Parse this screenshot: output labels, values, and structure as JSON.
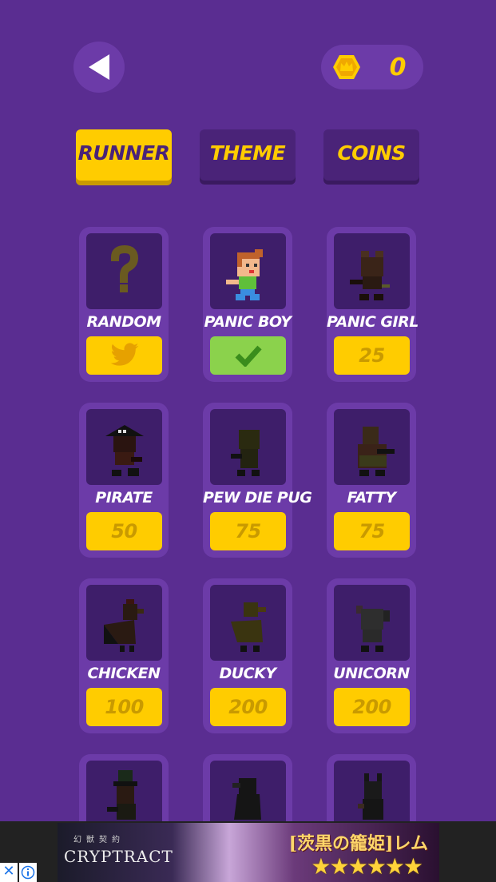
{
  "header": {
    "back_icon": "back-arrow-icon",
    "coin_icon": "crown-hexagon-coin-icon",
    "coin_count": "0"
  },
  "tabs": [
    {
      "label": "RUNNER",
      "active": true
    },
    {
      "label": "THEME",
      "active": false
    },
    {
      "label": "COINS",
      "active": false
    }
  ],
  "runners": [
    {
      "name": "RANDOM",
      "price": "",
      "button_icon": "twitter-icon",
      "owned": false
    },
    {
      "name": "PANIC BOY",
      "price": "",
      "button_icon": "checkmark-icon",
      "owned": true
    },
    {
      "name": "PANIC GIRL",
      "price": "25",
      "button_icon": "",
      "owned": false
    },
    {
      "name": "PIRATE",
      "price": "50",
      "button_icon": "",
      "owned": false
    },
    {
      "name": "PEW DIE PUG",
      "price": "75",
      "button_icon": "",
      "owned": false
    },
    {
      "name": "FATTY",
      "price": "75",
      "button_icon": "",
      "owned": false
    },
    {
      "name": "CHICKEN",
      "price": "100",
      "button_icon": "",
      "owned": false
    },
    {
      "name": "DUCKY",
      "price": "200",
      "button_icon": "",
      "owned": false
    },
    {
      "name": "UNICORN",
      "price": "200",
      "button_icon": "",
      "owned": false
    }
  ],
  "ad": {
    "logo": "CRYPTRACT",
    "logo_sub": "幻獣契約",
    "title": "[茨黒の籠姫]レム",
    "stars": "★★★★★★",
    "close_icon": "close-icon",
    "info_icon": "info-icon"
  },
  "colors": {
    "background": "#5a2d91",
    "accent": "#ffcc00",
    "owned": "#8bd24c"
  }
}
